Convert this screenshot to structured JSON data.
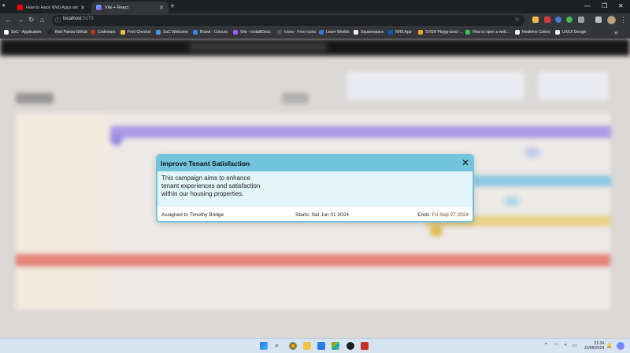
{
  "browser": {
    "tabs": [
      {
        "label": "How to Hack Web Apps with C",
        "favicon": "youtube-icon",
        "color": "#ff0000"
      },
      {
        "label": "Vite + React",
        "favicon": "vite-icon",
        "color": "#a259ff"
      }
    ],
    "address": {
      "host": "localhost",
      "port": ":5173"
    },
    "bookmarks": [
      {
        "label": "SoC - Application",
        "color": "#ffffff"
      },
      {
        "label": "Red Panda Github",
        "color": "#24292e"
      },
      {
        "label": "Codewars",
        "color": "#b1361e"
      },
      {
        "label": "Font Checker",
        "color": "#f2b84b"
      },
      {
        "label": "SoC Welcome",
        "color": "#4a9be0"
      },
      {
        "label": "Brand - Colours",
        "color": "#3b82f6"
      },
      {
        "label": "Vite - Install/Docs",
        "color": "#a259ff"
      },
      {
        "label": "Icons - Free Icons",
        "color": "#555555"
      },
      {
        "label": "Learn Worlds",
        "color": "#2e7dd7"
      },
      {
        "label": "Squarespace",
        "color": "#eeeeee"
      },
      {
        "label": "NHS App",
        "color": "#005eb8"
      },
      {
        "label": "SVGR Playground -...",
        "color": "#f5a623"
      },
      {
        "label": "How to open a web...",
        "color": "#35c759"
      },
      {
        "label": "Realtime Colors",
        "color": "#f5f5f5"
      },
      {
        "label": "UX/UI Design",
        "color": "#e8eaed"
      }
    ]
  },
  "modal": {
    "title": "Improve Tenant Satisfaction",
    "description": "This campaign aims to enhance tenant experiences and satisfaction within our housing properties.",
    "assigned_to": "Assigned to Timothy Bridge",
    "starts": "Starts: Sat Jun 01 2024",
    "ends_label": "Ends:",
    "ends_date": "Fri Sep 27 2024",
    "close_icon": "close-icon",
    "colors": {
      "header": "#72c3de",
      "body": "#e4f4fa",
      "border": "#72c3de"
    }
  },
  "taskbar": {
    "time": "21:34",
    "date": "21/05/2024"
  },
  "colors": {
    "purple_bar": "#b3a4f3",
    "blue_bar": "#8fd3ef",
    "yellow_bar": "#f3dd8e",
    "red_bar": "#f18a7f"
  }
}
